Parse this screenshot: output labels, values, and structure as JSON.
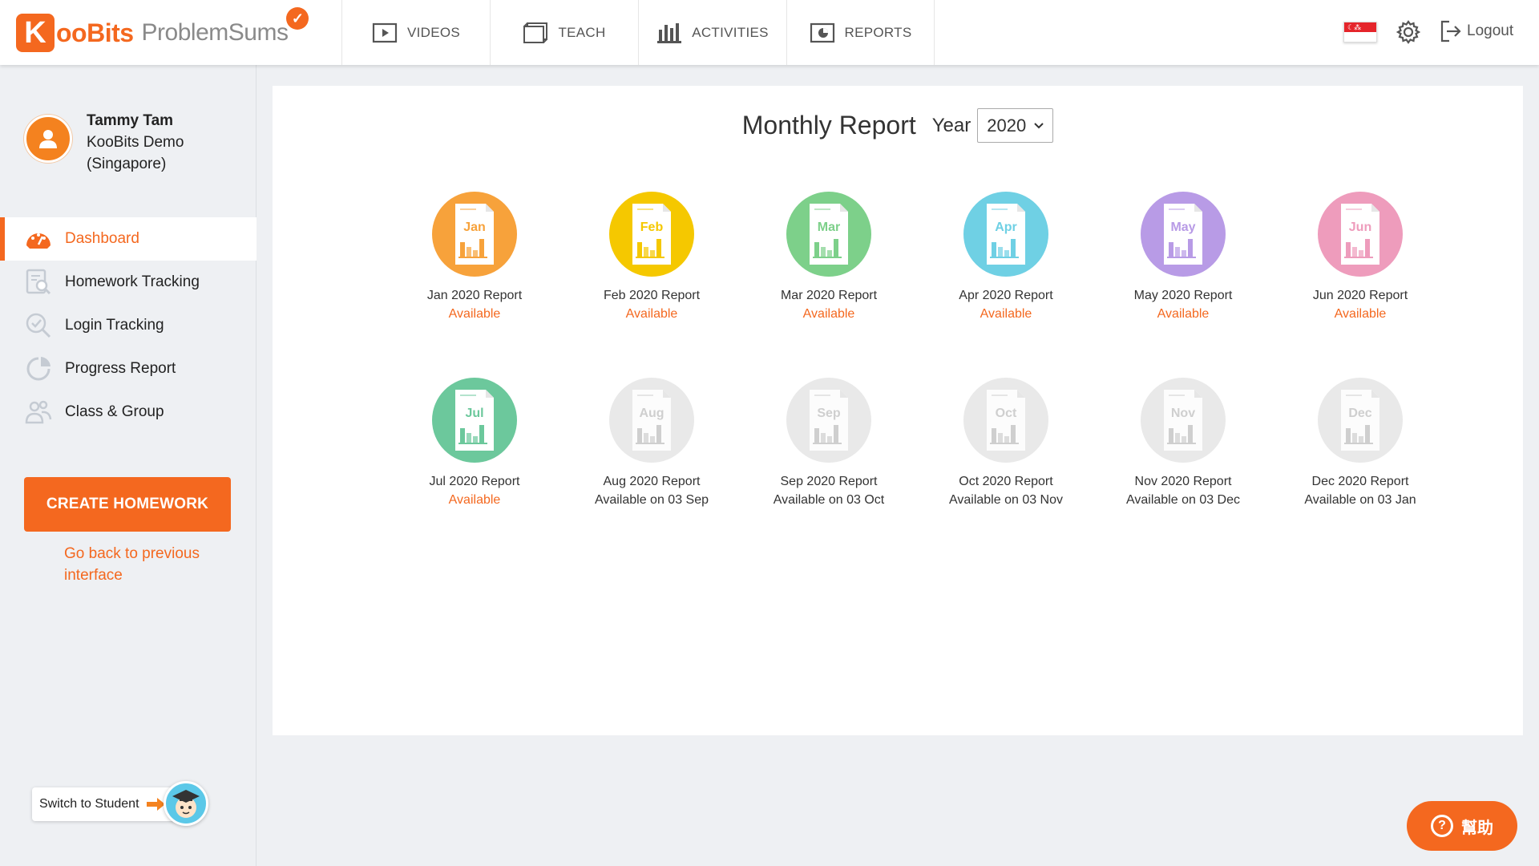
{
  "brand": {
    "logo_letter": "K",
    "logo_word": "ooBits",
    "product": "ProblemSums"
  },
  "nav": [
    {
      "label": "VIDEOS",
      "icon": "video-icon"
    },
    {
      "label": "TEACH",
      "icon": "teach-icon"
    },
    {
      "label": "ACTIVITIES",
      "icon": "activities-icon"
    },
    {
      "label": "REPORTS",
      "icon": "reports-icon"
    }
  ],
  "header_right": {
    "flag": "singapore-flag-icon",
    "settings_icon": "gear-icon",
    "logout_label": "Logout"
  },
  "profile": {
    "name": "Tammy Tam",
    "school_line1": "KooBits Demo",
    "school_line2": "(Singapore)"
  },
  "menu": [
    {
      "label": "Dashboard",
      "icon": "dashboard-icon",
      "active": true
    },
    {
      "label": "Homework Tracking",
      "icon": "homework-tracking-icon",
      "active": false
    },
    {
      "label": "Login Tracking",
      "icon": "login-tracking-icon",
      "active": false
    },
    {
      "label": "Progress Report",
      "icon": "progress-report-icon",
      "active": false
    },
    {
      "label": "Class & Group",
      "icon": "class-group-icon",
      "active": false
    }
  ],
  "create_homework_label": "CREATE HOMEWORK",
  "go_back_label": "Go back to previous interface",
  "switch_label": "Switch to Student",
  "main": {
    "title": "Monthly Report",
    "year_label": "Year",
    "year_value": "2020"
  },
  "reports": [
    {
      "month": "Jan",
      "name": "Jan 2020 Report",
      "status": "Available",
      "available": true,
      "color": "#f7a23b"
    },
    {
      "month": "Feb",
      "name": "Feb 2020 Report",
      "status": "Available",
      "available": true,
      "color": "#f5c800"
    },
    {
      "month": "Mar",
      "name": "Mar 2020 Report",
      "status": "Available",
      "available": true,
      "color": "#7dd08a"
    },
    {
      "month": "Apr",
      "name": "Apr 2020 Report",
      "status": "Available",
      "available": true,
      "color": "#6fd0e4"
    },
    {
      "month": "May",
      "name": "May 2020 Report",
      "status": "Available",
      "available": true,
      "color": "#b89be6"
    },
    {
      "month": "Jun",
      "name": "Jun 2020 Report",
      "status": "Available",
      "available": true,
      "color": "#ee9cbc"
    },
    {
      "month": "Jul",
      "name": "Jul 2020 Report",
      "status": "Available",
      "available": true,
      "color": "#6cc89c"
    },
    {
      "month": "Aug",
      "name": "Aug 2020 Report",
      "status": "Available on 03 Sep",
      "available": false,
      "color": "#e9e9e9"
    },
    {
      "month": "Sep",
      "name": "Sep 2020 Report",
      "status": "Available on 03 Oct",
      "available": false,
      "color": "#e9e9e9"
    },
    {
      "month": "Oct",
      "name": "Oct 2020 Report",
      "status": "Available on 03 Nov",
      "available": false,
      "color": "#e9e9e9"
    },
    {
      "month": "Nov",
      "name": "Nov 2020 Report",
      "status": "Available on 03 Dec",
      "available": false,
      "color": "#e9e9e9"
    },
    {
      "month": "Dec",
      "name": "Dec 2020 Report",
      "status": "Available on 03 Jan",
      "available": false,
      "color": "#e9e9e9"
    }
  ],
  "help_label": "幫助",
  "colors": {
    "accent": "#f4681f",
    "sidebar_bg": "#eef0f3"
  }
}
